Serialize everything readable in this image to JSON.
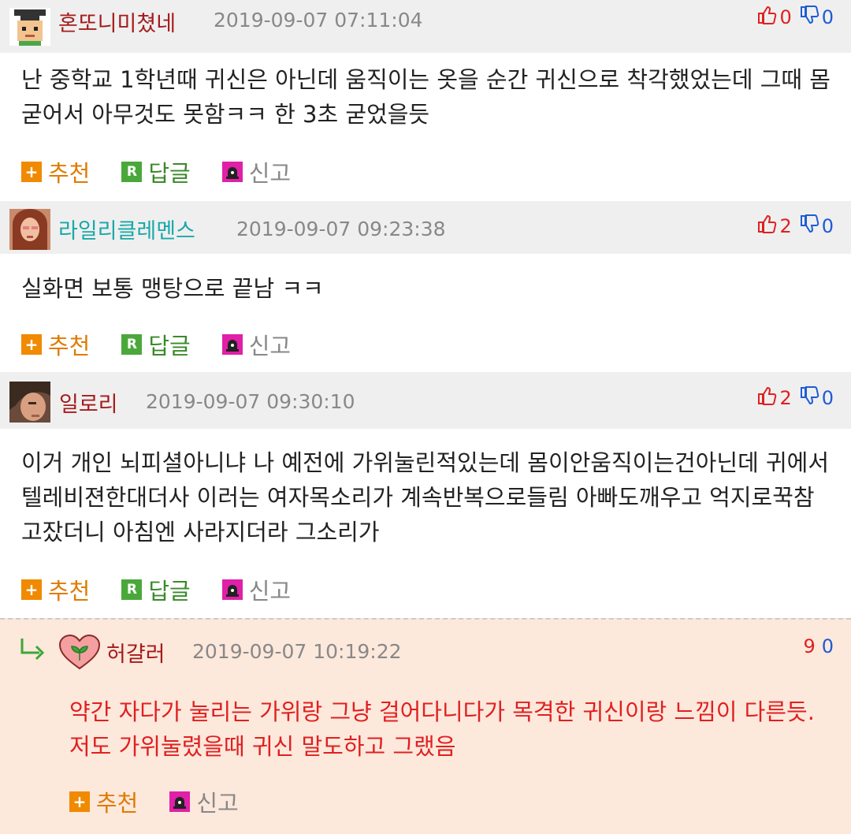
{
  "comments": [
    {
      "nick": "혼또니미쳤네",
      "nick_color": "#a51b1b",
      "date": "2019-09-07 07:11:04",
      "up": "0",
      "down": "0",
      "text": "난 중학교 1학년때 귀신은 아닌데 움직이는 옷을 순간 귀신으로 착각했었는데 그때 몸 굳어서 아무것도 못함ㅋㅋ 한 3초 굳었을듯"
    },
    {
      "nick": "라일리클레멘스",
      "nick_color": "#19a8a8",
      "date": "2019-09-07 09:23:38",
      "up": "2",
      "down": "0",
      "text": "실화면 보통 맹탕으로 끝남 ㅋㅋ"
    },
    {
      "nick": "일로리",
      "nick_color": "#a51b1b",
      "date": "2019-09-07 09:30:10",
      "up": "2",
      "down": "0",
      "text": "이거 개인 뇌피셜아니냐 나 예전에 가위눌린적있는데 몸이안움직이는건아닌데 귀에서 텔레비젼한대더사 이러는 여자목소리가 계속반복으로들림 아빠도깨우고 억지로꾹참고잤더니 아침엔 사라지더라 그소리가"
    }
  ],
  "reply": {
    "nick": "허걀러",
    "date": "2019-09-07 10:19:22",
    "up": "9",
    "down": "0",
    "text": "약간 자다가 눌리는 가위랑 그냥 걸어다니다가 목격한 귀신이랑 느낌이 다른듯. 저도 가위눌렸을때 귀신 말도하고 그랬음"
  },
  "actions": {
    "recommend": "추천",
    "reply": "답글",
    "report": "신고",
    "reply_box_glyph": "R",
    "recommend_box_glyph": "+"
  },
  "icons": [
    "thumbs-up-icon",
    "thumbs-down-icon",
    "plus-icon",
    "reply-r-icon",
    "siren-icon",
    "reply-arrow-icon",
    "heart-leaf-icon"
  ],
  "colors": {
    "header_bg": "#efefef",
    "reply_bg": "#fde8dc",
    "up": "#e02020",
    "down": "#1e5bd6",
    "reply_text": "#e02020"
  }
}
